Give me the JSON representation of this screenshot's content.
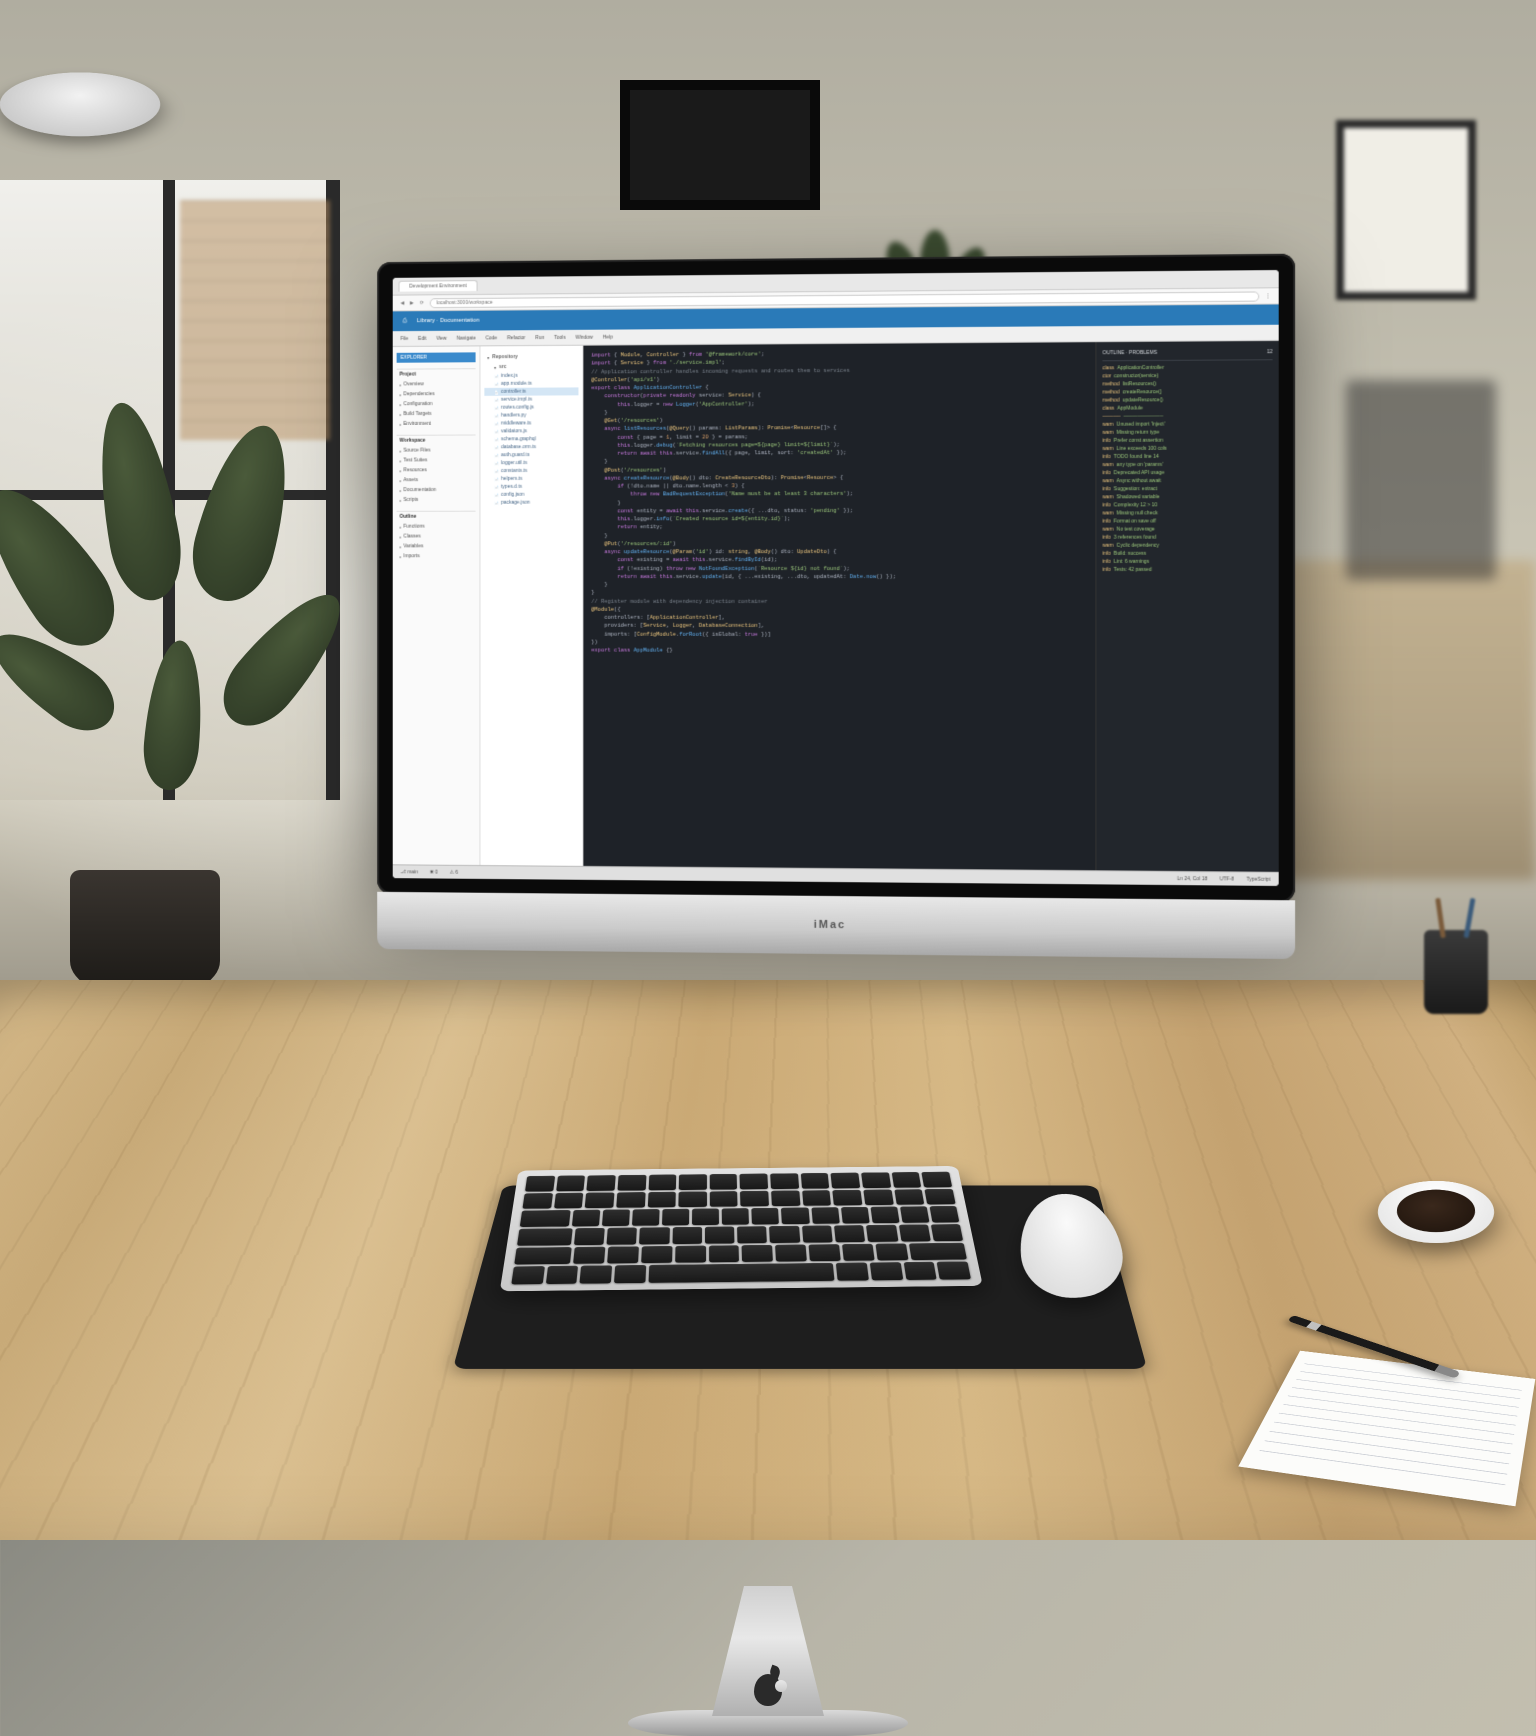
{
  "browser": {
    "tab_title": "Development Environment",
    "address": "localhost:3000/workspace"
  },
  "banner": {
    "icon_label": "⎙",
    "title": "Library · Documentation"
  },
  "toolbar": {
    "items": [
      "File",
      "Edit",
      "View",
      "Navigate",
      "Code",
      "Refactor",
      "Run",
      "Tools",
      "Window",
      "Help"
    ]
  },
  "sidebar": {
    "title": "EXPLORER",
    "sections": [
      {
        "name": "Project",
        "items": [
          "Overview",
          "Dependencies",
          "Configuration",
          "Build Targets",
          "Environment"
        ]
      },
      {
        "name": "Workspace",
        "items": [
          "Source Files",
          "Test Suites",
          "Resources",
          "Assets",
          "Documentation",
          "Scripts"
        ]
      },
      {
        "name": "Outline",
        "items": [
          "Functions",
          "Classes",
          "Variables",
          "Imports"
        ]
      }
    ]
  },
  "filetree": {
    "header": "Repository",
    "subheader": "src",
    "items": [
      "index.js",
      "app.module.ts",
      "controller.ts",
      "service.impl.ts",
      "routes.config.js",
      "handlers.py",
      "middleware.ts",
      "validators.js",
      "schema.graphql",
      "database.orm.ts",
      "auth.guard.ts",
      "logger.util.ts",
      "constants.ts",
      "helpers.ts",
      "types.d.ts",
      "config.json",
      "package.json"
    ],
    "active_index": 2
  },
  "editor": {
    "lines": [
      {
        "indent": 0,
        "tokens": [
          [
            "kw",
            "import"
          ],
          [
            "pl",
            " { "
          ],
          [
            "hl",
            "Module"
          ],
          [
            "pl",
            ", "
          ],
          [
            "hl",
            "Controller"
          ],
          [
            "pl",
            " } "
          ],
          [
            "kw",
            "from"
          ],
          [
            "pl",
            " "
          ],
          [
            "str",
            "'@framework/core'"
          ],
          [
            "pl",
            ";"
          ]
        ]
      },
      {
        "indent": 0,
        "tokens": [
          [
            "kw",
            "import"
          ],
          [
            "pl",
            " { "
          ],
          [
            "hl",
            "Service"
          ],
          [
            "pl",
            " } "
          ],
          [
            "kw",
            "from"
          ],
          [
            "pl",
            " "
          ],
          [
            "str",
            "'./service.impl'"
          ],
          [
            "pl",
            ";"
          ]
        ]
      },
      {
        "indent": 0,
        "tokens": [
          [
            "pl",
            ""
          ]
        ]
      },
      {
        "indent": 0,
        "tokens": [
          [
            "cm",
            "// Application controller handles incoming requests and routes them to services"
          ]
        ]
      },
      {
        "indent": 0,
        "tokens": [
          [
            "hl",
            "@Controller"
          ],
          [
            "pl",
            "("
          ],
          [
            "str",
            "'api/v1'"
          ],
          [
            "pl",
            ")"
          ]
        ]
      },
      {
        "indent": 0,
        "tokens": [
          [
            "kw",
            "export class"
          ],
          [
            "pl",
            " "
          ],
          [
            "fn",
            "ApplicationController"
          ],
          [
            "pl",
            " {"
          ]
        ]
      },
      {
        "indent": 1,
        "tokens": [
          [
            "kw",
            "constructor"
          ],
          [
            "pl",
            "("
          ],
          [
            "kw",
            "private readonly"
          ],
          [
            "pl",
            " service: "
          ],
          [
            "hl",
            "Service"
          ],
          [
            "pl",
            ") {"
          ]
        ]
      },
      {
        "indent": 2,
        "tokens": [
          [
            "kw",
            "this"
          ],
          [
            "pl",
            ".logger = "
          ],
          [
            "kw",
            "new"
          ],
          [
            "pl",
            " "
          ],
          [
            "fn",
            "Logger"
          ],
          [
            "pl",
            "("
          ],
          [
            "str",
            "'AppController'"
          ],
          [
            "pl",
            ");"
          ]
        ]
      },
      {
        "indent": 1,
        "tokens": [
          [
            "pl",
            "}"
          ]
        ]
      },
      {
        "indent": 0,
        "tokens": [
          [
            "pl",
            ""
          ]
        ]
      },
      {
        "indent": 1,
        "tokens": [
          [
            "hl",
            "@Get"
          ],
          [
            "pl",
            "("
          ],
          [
            "str",
            "'/resources'"
          ],
          [
            "pl",
            ")"
          ]
        ]
      },
      {
        "indent": 1,
        "tokens": [
          [
            "kw",
            "async"
          ],
          [
            "pl",
            " "
          ],
          [
            "fn",
            "listResources"
          ],
          [
            "pl",
            "("
          ],
          [
            "hl",
            "@Query"
          ],
          [
            "pl",
            "() params: "
          ],
          [
            "hl",
            "ListParams"
          ],
          [
            "pl",
            "): "
          ],
          [
            "hl",
            "Promise"
          ],
          [
            "pl",
            "<"
          ],
          [
            "hl",
            "Resource"
          ],
          [
            "pl",
            "[]> {"
          ]
        ]
      },
      {
        "indent": 2,
        "tokens": [
          [
            "kw",
            "const"
          ],
          [
            "pl",
            " { page = "
          ],
          [
            "num",
            "1"
          ],
          [
            "pl",
            ", limit = "
          ],
          [
            "num",
            "20"
          ],
          [
            "pl",
            " } = params;"
          ]
        ]
      },
      {
        "indent": 2,
        "tokens": [
          [
            "kw",
            "this"
          ],
          [
            "pl",
            ".logger."
          ],
          [
            "fn",
            "debug"
          ],
          [
            "pl",
            "("
          ],
          [
            "str",
            "`Fetching resources page=${page} limit=${limit}`"
          ],
          [
            "pl",
            ");"
          ]
        ]
      },
      {
        "indent": 2,
        "tokens": [
          [
            "kw",
            "return await"
          ],
          [
            "pl",
            " "
          ],
          [
            "kw",
            "this"
          ],
          [
            "pl",
            ".service."
          ],
          [
            "fn",
            "findAll"
          ],
          [
            "pl",
            "({ page, limit, sort: "
          ],
          [
            "str",
            "'createdAt'"
          ],
          [
            "pl",
            " });"
          ]
        ]
      },
      {
        "indent": 1,
        "tokens": [
          [
            "pl",
            "}"
          ]
        ]
      },
      {
        "indent": 0,
        "tokens": [
          [
            "pl",
            ""
          ]
        ]
      },
      {
        "indent": 1,
        "tokens": [
          [
            "hl",
            "@Post"
          ],
          [
            "pl",
            "("
          ],
          [
            "str",
            "'/resources'"
          ],
          [
            "pl",
            ")"
          ]
        ]
      },
      {
        "indent": 1,
        "tokens": [
          [
            "kw",
            "async"
          ],
          [
            "pl",
            " "
          ],
          [
            "fn",
            "createResource"
          ],
          [
            "pl",
            "("
          ],
          [
            "hl",
            "@Body"
          ],
          [
            "pl",
            "() dto: "
          ],
          [
            "hl",
            "CreateResourceDto"
          ],
          [
            "pl",
            "): "
          ],
          [
            "hl",
            "Promise"
          ],
          [
            "pl",
            "<"
          ],
          [
            "hl",
            "Resource"
          ],
          [
            "pl",
            "> {"
          ]
        ]
      },
      {
        "indent": 2,
        "tokens": [
          [
            "kw",
            "if"
          ],
          [
            "pl",
            " (!dto.name || dto.name.length < "
          ],
          [
            "num",
            "3"
          ],
          [
            "pl",
            ") {"
          ]
        ]
      },
      {
        "indent": 3,
        "tokens": [
          [
            "kw",
            "throw new"
          ],
          [
            "pl",
            " "
          ],
          [
            "fn",
            "BadRequestException"
          ],
          [
            "pl",
            "("
          ],
          [
            "str",
            "'Name must be at least 3 characters'"
          ],
          [
            "pl",
            ");"
          ]
        ]
      },
      {
        "indent": 2,
        "tokens": [
          [
            "pl",
            "}"
          ]
        ]
      },
      {
        "indent": 2,
        "tokens": [
          [
            "kw",
            "const"
          ],
          [
            "pl",
            " entity = "
          ],
          [
            "kw",
            "await this"
          ],
          [
            "pl",
            ".service."
          ],
          [
            "fn",
            "create"
          ],
          [
            "pl",
            "({ ...dto, status: "
          ],
          [
            "str",
            "'pending'"
          ],
          [
            "pl",
            " });"
          ]
        ]
      },
      {
        "indent": 2,
        "tokens": [
          [
            "kw",
            "this"
          ],
          [
            "pl",
            ".logger."
          ],
          [
            "fn",
            "info"
          ],
          [
            "pl",
            "("
          ],
          [
            "str",
            "`Created resource id=${entity.id}`"
          ],
          [
            "pl",
            ");"
          ]
        ]
      },
      {
        "indent": 2,
        "tokens": [
          [
            "kw",
            "return"
          ],
          [
            "pl",
            " entity;"
          ]
        ]
      },
      {
        "indent": 1,
        "tokens": [
          [
            "pl",
            "}"
          ]
        ]
      },
      {
        "indent": 0,
        "tokens": [
          [
            "pl",
            ""
          ]
        ]
      },
      {
        "indent": 1,
        "tokens": [
          [
            "hl",
            "@Put"
          ],
          [
            "pl",
            "("
          ],
          [
            "str",
            "'/resources/:id'"
          ],
          [
            "pl",
            ")"
          ]
        ]
      },
      {
        "indent": 1,
        "tokens": [
          [
            "kw",
            "async"
          ],
          [
            "pl",
            " "
          ],
          [
            "fn",
            "updateResource"
          ],
          [
            "pl",
            "("
          ],
          [
            "hl",
            "@Param"
          ],
          [
            "pl",
            "("
          ],
          [
            "str",
            "'id'"
          ],
          [
            "pl",
            ") id: "
          ],
          [
            "hl",
            "string"
          ],
          [
            "pl",
            ", "
          ],
          [
            "hl",
            "@Body"
          ],
          [
            "pl",
            "() dto: "
          ],
          [
            "hl",
            "UpdateDto"
          ],
          [
            "pl",
            ") {"
          ]
        ]
      },
      {
        "indent": 2,
        "tokens": [
          [
            "kw",
            "const"
          ],
          [
            "pl",
            " existing = "
          ],
          [
            "kw",
            "await this"
          ],
          [
            "pl",
            ".service."
          ],
          [
            "fn",
            "findById"
          ],
          [
            "pl",
            "(id);"
          ]
        ]
      },
      {
        "indent": 2,
        "tokens": [
          [
            "kw",
            "if"
          ],
          [
            "pl",
            " (!existing) "
          ],
          [
            "kw",
            "throw new"
          ],
          [
            "pl",
            " "
          ],
          [
            "fn",
            "NotFoundException"
          ],
          [
            "pl",
            "("
          ],
          [
            "str",
            "`Resource ${id} not found`"
          ],
          [
            "pl",
            ");"
          ]
        ]
      },
      {
        "indent": 2,
        "tokens": [
          [
            "kw",
            "return await this"
          ],
          [
            "pl",
            ".service."
          ],
          [
            "fn",
            "update"
          ],
          [
            "pl",
            "(id, { ...existing, ...dto, updatedAt: "
          ],
          [
            "fn",
            "Date.now"
          ],
          [
            "pl",
            "() });"
          ]
        ]
      },
      {
        "indent": 1,
        "tokens": [
          [
            "pl",
            "}"
          ]
        ]
      },
      {
        "indent": 0,
        "tokens": [
          [
            "pl",
            "}"
          ]
        ]
      },
      {
        "indent": 0,
        "tokens": [
          [
            "pl",
            ""
          ]
        ]
      },
      {
        "indent": 0,
        "tokens": [
          [
            "cm",
            "// Register module with dependency injection container"
          ]
        ]
      },
      {
        "indent": 0,
        "tokens": [
          [
            "hl",
            "@Module"
          ],
          [
            "pl",
            "({"
          ]
        ]
      },
      {
        "indent": 1,
        "tokens": [
          [
            "pl",
            "controllers: ["
          ],
          [
            "hl",
            "ApplicationController"
          ],
          [
            "pl",
            "],"
          ]
        ]
      },
      {
        "indent": 1,
        "tokens": [
          [
            "pl",
            "providers: ["
          ],
          [
            "hl",
            "Service"
          ],
          [
            "pl",
            ", "
          ],
          [
            "hl",
            "Logger"
          ],
          [
            "pl",
            ", "
          ],
          [
            "hl",
            "DatabaseConnection"
          ],
          [
            "pl",
            "],"
          ]
        ]
      },
      {
        "indent": 1,
        "tokens": [
          [
            "pl",
            "imports: ["
          ],
          [
            "hl",
            "ConfigModule"
          ],
          [
            "pl",
            "."
          ],
          [
            "fn",
            "forRoot"
          ],
          [
            "pl",
            "({ isGlobal: "
          ],
          [
            "kw",
            "true"
          ],
          [
            "pl",
            " })]"
          ]
        ]
      },
      {
        "indent": 0,
        "tokens": [
          [
            "pl",
            "})"
          ]
        ]
      },
      {
        "indent": 0,
        "tokens": [
          [
            "kw",
            "export class"
          ],
          [
            "pl",
            " "
          ],
          [
            "fn",
            "AppModule"
          ],
          [
            "pl",
            " {}"
          ]
        ]
      }
    ]
  },
  "right_panel": {
    "title": "OUTLINE · PROBLEMS",
    "count": "12",
    "entries": [
      {
        "k": "class",
        "v": "ApplicationController"
      },
      {
        "k": "ctor",
        "v": "constructor(service)"
      },
      {
        "k": "method",
        "v": "listResources()"
      },
      {
        "k": "method",
        "v": "createResource()"
      },
      {
        "k": "method",
        "v": "updateResource()"
      },
      {
        "k": "class",
        "v": "AppModule"
      },
      {
        "k": "─────",
        "v": "───────────"
      },
      {
        "k": "warn",
        "v": "Unused import 'Inject'"
      },
      {
        "k": "warn",
        "v": "Missing return type"
      },
      {
        "k": "info",
        "v": "Prefer const assertion"
      },
      {
        "k": "warn",
        "v": "Line exceeds 100 cols"
      },
      {
        "k": "info",
        "v": "TODO found line 14"
      },
      {
        "k": "warn",
        "v": "any type on 'params'"
      },
      {
        "k": "info",
        "v": "Deprecated API usage"
      },
      {
        "k": "warn",
        "v": "Async without await"
      },
      {
        "k": "info",
        "v": "Suggestion: extract"
      },
      {
        "k": "warn",
        "v": "Shadowed variable"
      },
      {
        "k": "info",
        "v": "Complexity 12 > 10"
      },
      {
        "k": "warn",
        "v": "Missing null check"
      },
      {
        "k": "info",
        "v": "Format on save off"
      },
      {
        "k": "warn",
        "v": "No test coverage"
      },
      {
        "k": "info",
        "v": "3 references found"
      },
      {
        "k": "warn",
        "v": "Cyclic dependency"
      },
      {
        "k": "info",
        "v": "Build: success"
      },
      {
        "k": "info",
        "v": "Lint: 6 warnings"
      },
      {
        "k": "info",
        "v": "Tests: 42 passed"
      }
    ]
  },
  "statusbar": {
    "branch": "main",
    "errors": "0",
    "warnings": "6",
    "position": "Ln 24, Col 18",
    "encoding": "UTF-8",
    "lang": "TypeScript"
  },
  "monitor_brand": "iMac"
}
